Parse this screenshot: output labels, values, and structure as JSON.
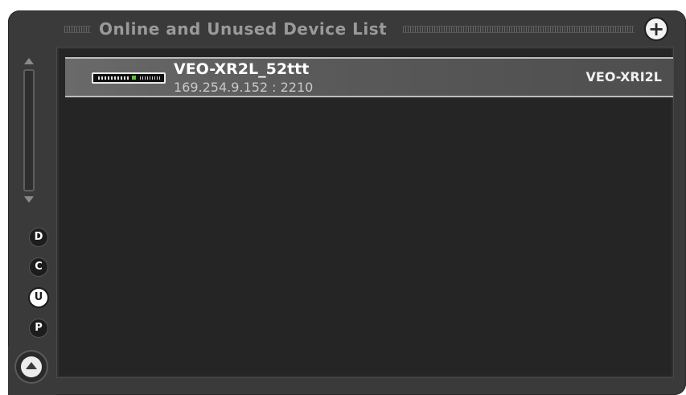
{
  "panel": {
    "title": "Online and Unused Device List",
    "add_button_glyph": "+"
  },
  "devices": [
    {
      "name": "VEO-XR2L_52ttt",
      "address": "169.254.9.152 : 2210",
      "model": "VEO-XRI2L",
      "icon": "device-front-panel-icon"
    }
  ],
  "filters": [
    {
      "label": "D",
      "active": false
    },
    {
      "label": "C",
      "active": false
    },
    {
      "label": "U",
      "active": true
    },
    {
      "label": "P",
      "active": false
    }
  ],
  "colors": {
    "panel_bg": "#3a3a3a",
    "list_bg": "#252525",
    "row_highlight": "#5a5a5a",
    "title_text": "#9a9a9a"
  }
}
